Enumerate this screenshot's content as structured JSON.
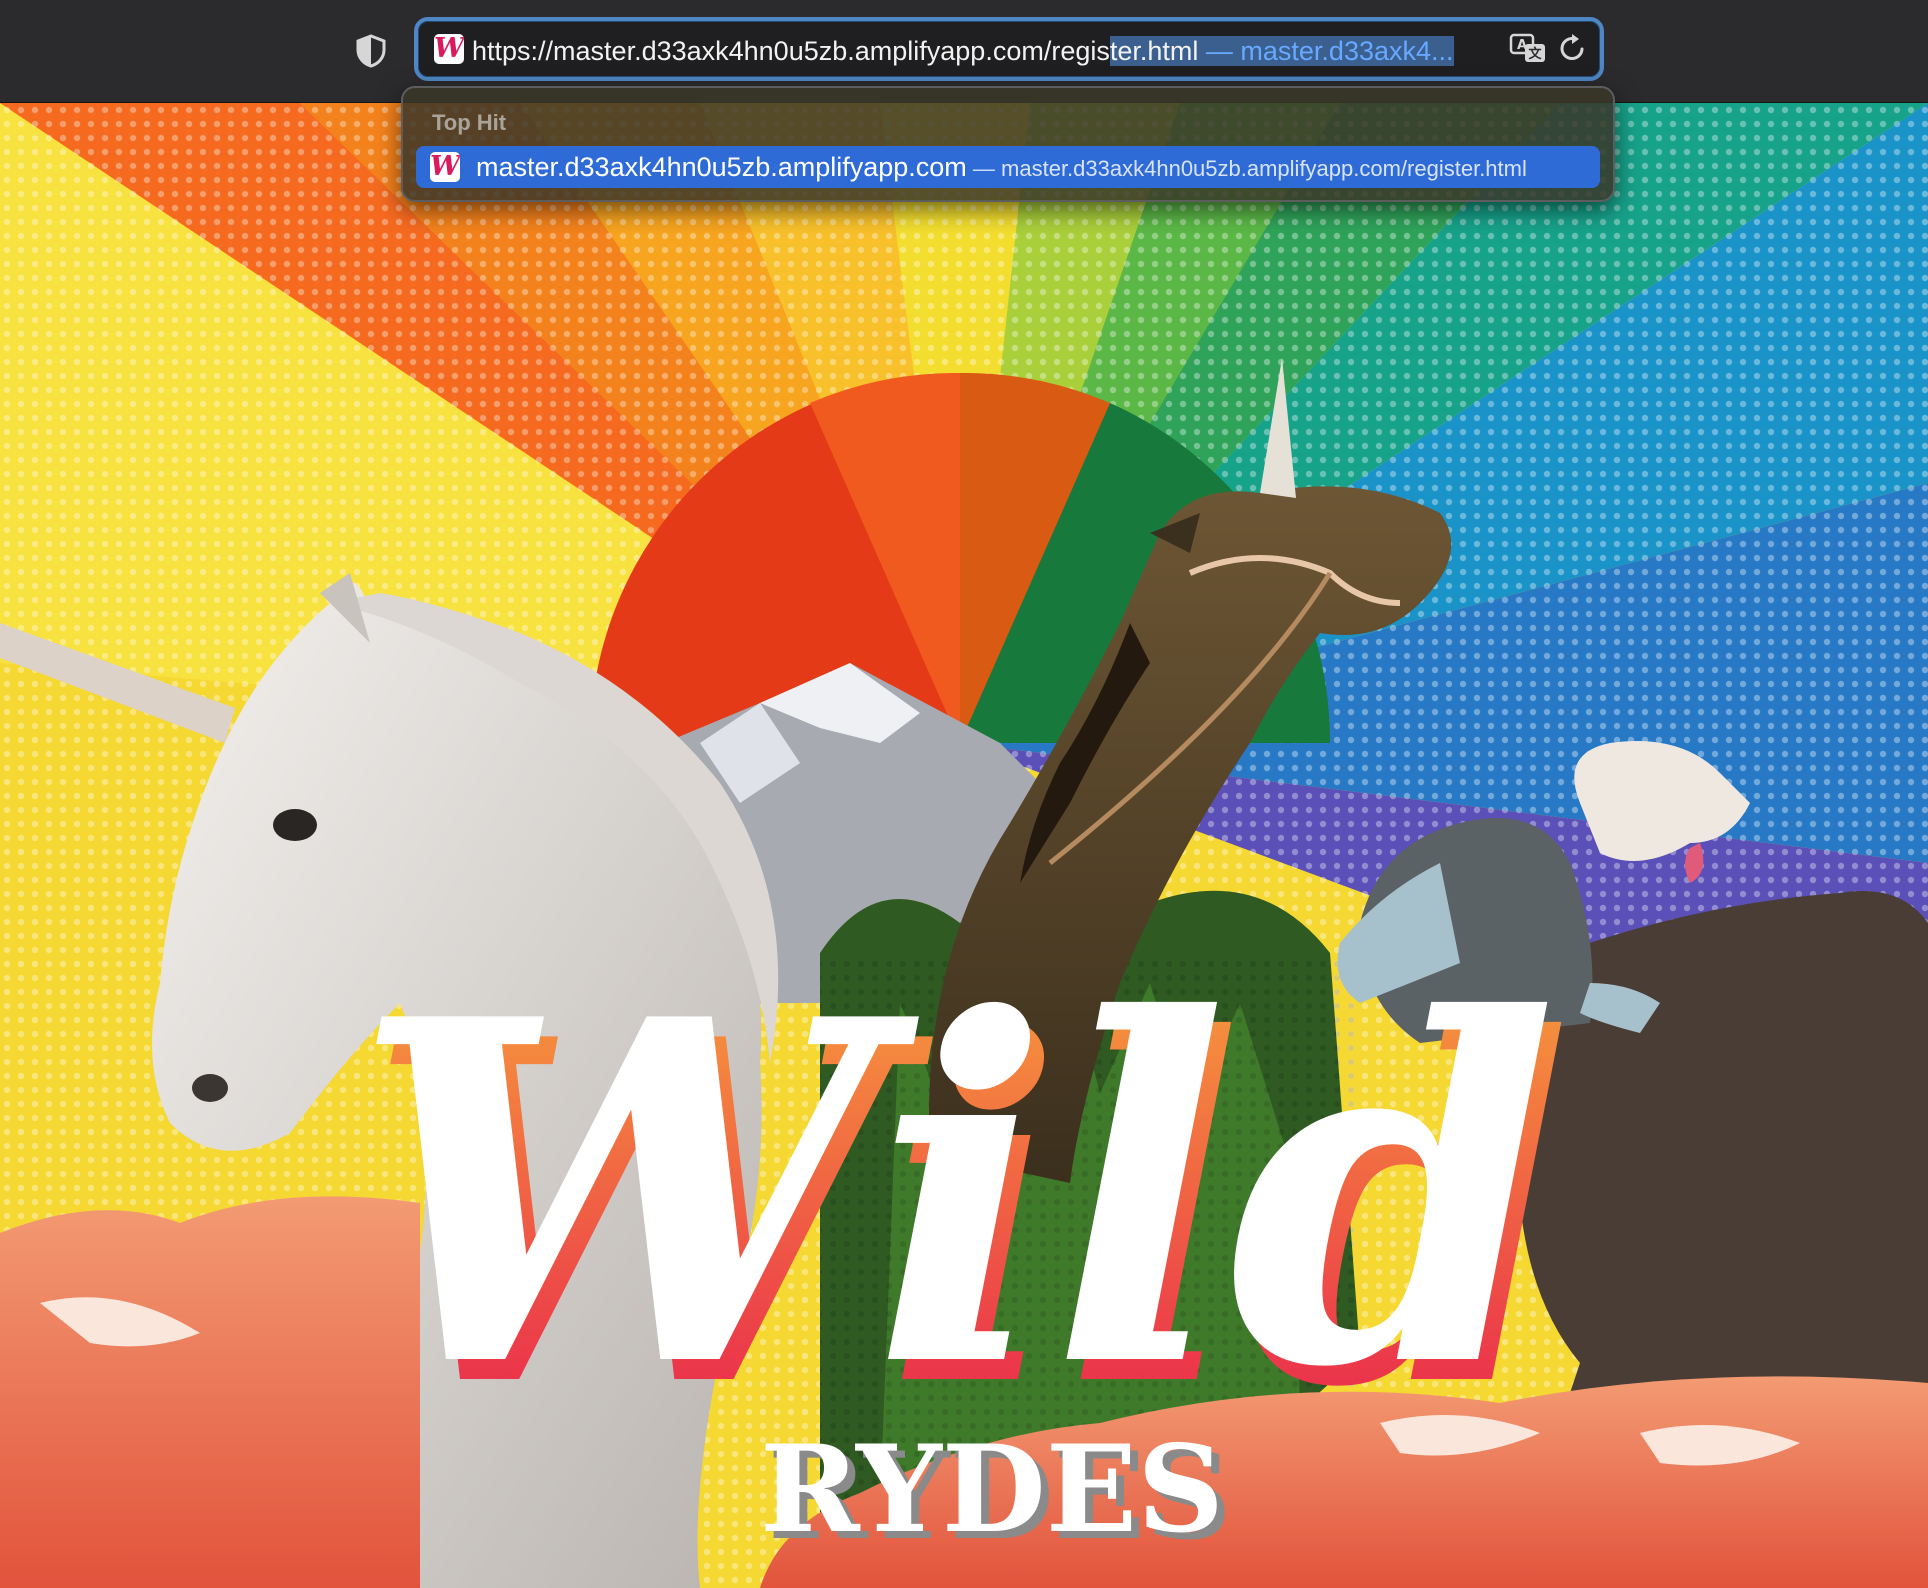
{
  "toolbar": {
    "url_base": "https://master.d33axk4hn0u5zb.amplifyapp.com/regis",
    "url_selected": "ter.html",
    "url_inline_suffix": " — master.d33axk4...",
    "icons": [
      "shield-icon",
      "favicon-icon",
      "translate-icon",
      "reload-icon"
    ]
  },
  "dropdown": {
    "header": "Top Hit",
    "item": {
      "title": "master.d33axk4hn0u5zb.amplifyapp.com",
      "separator": " — ",
      "url": "master.d33axk4hn0u5zb.amplifyapp.com/register.html"
    }
  },
  "favicon": {
    "glyph": "W"
  },
  "hero": {
    "logo_main": "Wild",
    "logo_sub": "RYDES"
  },
  "colors": {
    "accent": "#2f6bd6",
    "focus_ring": "#4f86c4",
    "logo_gradient_top": "#f7a33a",
    "logo_gradient_bottom": "#e8194f"
  }
}
